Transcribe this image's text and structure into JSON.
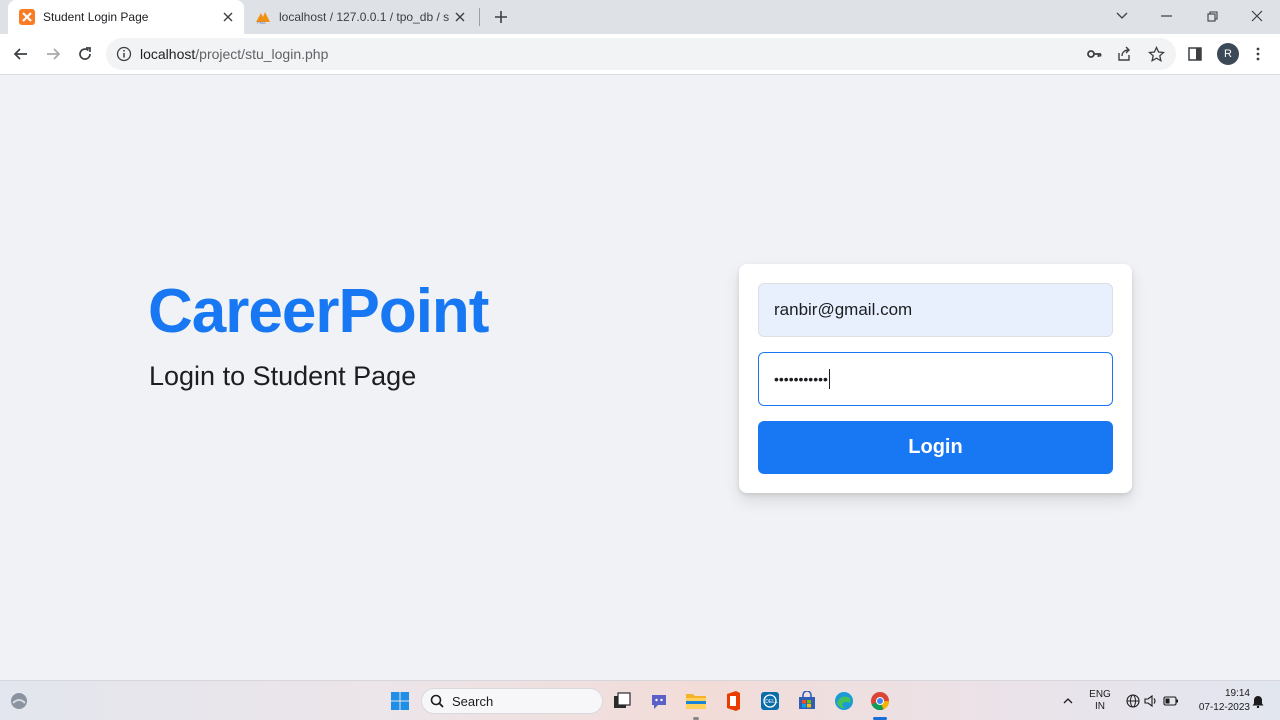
{
  "browser": {
    "tabs": [
      {
        "title": "Student Login Page",
        "active": true
      },
      {
        "title": "localhost / 127.0.0.1 / tpo_db / s",
        "active": false
      }
    ],
    "address": {
      "host": "localhost",
      "path": "/project/stu_login.php"
    },
    "profile_initial": "R"
  },
  "page": {
    "brand": "CareerPoint",
    "tagline": "Login to Student Page",
    "form": {
      "email_value": "ranbir@gmail.com",
      "password_mask": "•••••••••••",
      "login_label": "Login"
    }
  },
  "taskbar": {
    "search_placeholder": "Search",
    "language": "ENG",
    "region": "IN",
    "time": "19:14",
    "date": "07-12-2023"
  },
  "colors": {
    "brand": "#1877f2",
    "page_bg": "#f0f2f5",
    "autofill_bg": "#e8f0fe"
  }
}
